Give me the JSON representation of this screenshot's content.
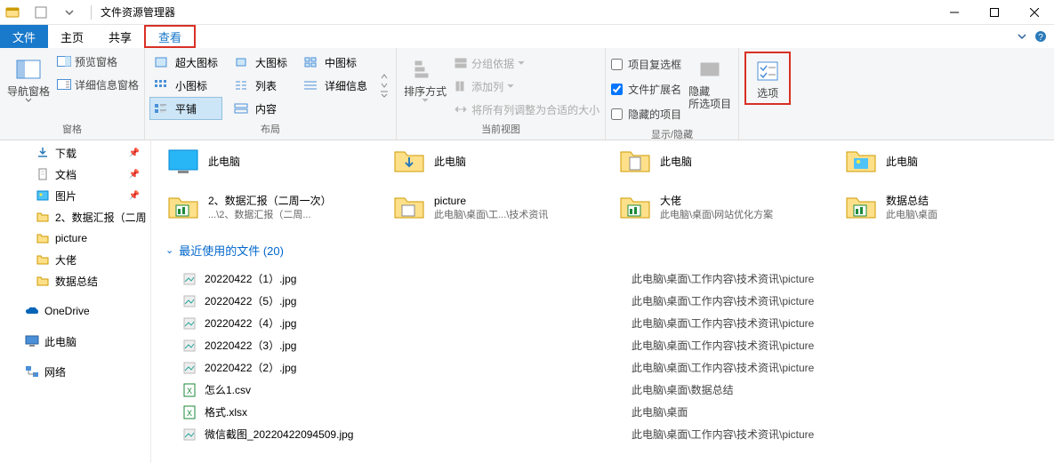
{
  "window": {
    "title": "文件资源管理器"
  },
  "tabs": {
    "file": "文件",
    "home": "主页",
    "share": "共享",
    "view": "查看"
  },
  "ribbon": {
    "panes_group": "窗格",
    "layout_group": "布局",
    "current_view_group": "当前视图",
    "show_hide_group": "显示/隐藏",
    "nav_pane": "导航窗格",
    "preview_pane": "预览窗格",
    "details_pane": "详细信息窗格",
    "layouts": {
      "xl_icons": "超大图标",
      "l_icons": "大图标",
      "m_icons": "中图标",
      "s_icons": "小图标",
      "list": "列表",
      "details": "详细信息",
      "tiles": "平铺",
      "content": "内容"
    },
    "sort_by": "排序方式",
    "group_by": "分组依据",
    "add_columns": "添加列",
    "fit_columns": "将所有列调整为合适的大小",
    "item_checkboxes": "项目复选框",
    "file_ext": "文件扩展名",
    "hidden_items": "隐藏的项目",
    "hide_selected": "隐藏",
    "hide_selected_sub": "所选项目",
    "options": "选项"
  },
  "nav": {
    "downloads": "下载",
    "docs": "文档",
    "pictures": "图片",
    "item_report": "2、数据汇报（二周",
    "picture_folder": "picture",
    "dalao": "大佬",
    "data_summary": "数据总结",
    "onedrive": "OneDrive",
    "this_pc": "此电脑",
    "network": "网络"
  },
  "top_tiles": [
    {
      "name": "此电脑",
      "icon": "desktop"
    },
    {
      "name": "此电脑",
      "icon": "downloads"
    },
    {
      "name": "此电脑",
      "icon": "documents"
    },
    {
      "name": "此电脑",
      "icon": "pictures"
    }
  ],
  "folder_tiles": [
    {
      "name": "2、数据汇报（二周一次）",
      "sub": "...\\2、数据汇报（二周..."
    },
    {
      "name": "picture",
      "sub": "此电脑\\桌面\\工...\\技术资讯"
    },
    {
      "name": "大佬",
      "sub": "此电脑\\桌面\\网站优化方案"
    },
    {
      "name": "数据总结",
      "sub": "此电脑\\桌面"
    }
  ],
  "section": "最近使用的文件 (20)",
  "recent_files": [
    {
      "icon": "jpg",
      "name": "20220422（1）.jpg",
      "path": "此电脑\\桌面\\工作内容\\技术资讯\\picture"
    },
    {
      "icon": "jpg",
      "name": "20220422（5）.jpg",
      "path": "此电脑\\桌面\\工作内容\\技术资讯\\picture"
    },
    {
      "icon": "jpg",
      "name": "20220422（4）.jpg",
      "path": "此电脑\\桌面\\工作内容\\技术资讯\\picture"
    },
    {
      "icon": "jpg",
      "name": "20220422（3）.jpg",
      "path": "此电脑\\桌面\\工作内容\\技术资讯\\picture"
    },
    {
      "icon": "jpg",
      "name": "20220422（2）.jpg",
      "path": "此电脑\\桌面\\工作内容\\技术资讯\\picture"
    },
    {
      "icon": "csv",
      "name": "怎么1.csv",
      "path": "此电脑\\桌面\\数据总结"
    },
    {
      "icon": "xlsx",
      "name": "格式.xlsx",
      "path": "此电脑\\桌面"
    },
    {
      "icon": "jpg",
      "name": "微信截图_20220422094509.jpg",
      "path": "此电脑\\桌面\\工作内容\\技术资讯\\picture"
    }
  ]
}
